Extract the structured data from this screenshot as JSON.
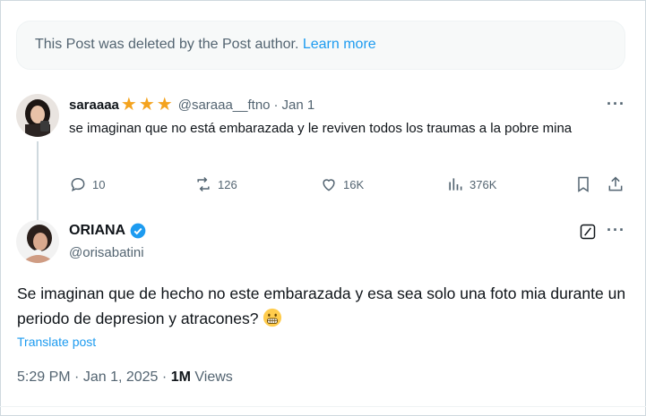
{
  "deleted_notice": {
    "text": "This Post was deleted by the Post author.",
    "link": "Learn more"
  },
  "reply": {
    "name": "saraaaa",
    "stars": [
      "★",
      "★",
      "★"
    ],
    "handle": "@saraaa__ftno",
    "separator": "·",
    "date": "Jan 1",
    "text": "se imaginan que no está embarazada y le reviven todos los traumas a la pobre mina",
    "more_icon": "more-dots-icon",
    "actions": {
      "replies": "10",
      "reposts": "126",
      "likes": "16K",
      "views": "376K"
    }
  },
  "post": {
    "name": "ORIANA",
    "verified_icon": "verified-badge-icon",
    "handle": "@orisabatini",
    "text": "Se imaginan que de hecho no este embarazada y esa sea solo una foto mia durante un periodo de depresion y atracones?",
    "emoji": "grimacing-face",
    "translate_label": "Translate post",
    "time": "5:29 PM",
    "date": "Jan 1, 2025",
    "views_count": "1M",
    "views_label": "Views",
    "dot": "·"
  },
  "colors": {
    "accent": "#1d9bf0",
    "star": "#f4a31e",
    "muted": "#536471",
    "text": "#0f1419"
  }
}
